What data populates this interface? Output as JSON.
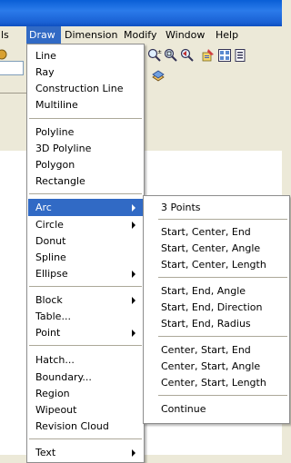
{
  "menubar": {
    "items": [
      {
        "label": "ls"
      },
      {
        "label": "Draw"
      },
      {
        "label": "Dimension"
      },
      {
        "label": "Modify"
      },
      {
        "label": "Window"
      },
      {
        "label": "Help"
      }
    ]
  },
  "toolbar": {
    "icons": [
      "zoom-realtime-icon",
      "zoom-window-icon",
      "zoom-previous-icon",
      "properties-icon",
      "design-center-icon",
      "tool-palettes-icon",
      "layer-icon"
    ]
  },
  "draw_menu": {
    "items": [
      {
        "label": "Line"
      },
      {
        "label": "Ray"
      },
      {
        "label": "Construction Line"
      },
      {
        "label": "Multiline"
      },
      {
        "label": "Polyline"
      },
      {
        "label": "3D Polyline"
      },
      {
        "label": "Polygon"
      },
      {
        "label": "Rectangle"
      },
      {
        "label": "Arc",
        "submenu": true,
        "highlighted": true
      },
      {
        "label": "Circle",
        "submenu": true
      },
      {
        "label": "Donut"
      },
      {
        "label": "Spline"
      },
      {
        "label": "Ellipse",
        "submenu": true
      },
      {
        "label": "Block",
        "submenu": true
      },
      {
        "label": "Table..."
      },
      {
        "label": "Point",
        "submenu": true
      },
      {
        "label": "Hatch..."
      },
      {
        "label": "Boundary..."
      },
      {
        "label": "Region"
      },
      {
        "label": "Wipeout"
      },
      {
        "label": "Revision Cloud"
      },
      {
        "label": "Text",
        "submenu": true
      }
    ]
  },
  "arc_submenu": {
    "items": [
      {
        "label": "3 Points"
      },
      {
        "label": "Start, Center, End"
      },
      {
        "label": "Start, Center, Angle"
      },
      {
        "label": "Start, Center, Length"
      },
      {
        "label": "Start, End, Angle"
      },
      {
        "label": "Start, End, Direction"
      },
      {
        "label": "Start, End, Radius"
      },
      {
        "label": "Center, Start, End"
      },
      {
        "label": "Center, Start, Angle"
      },
      {
        "label": "Center, Start, Length"
      },
      {
        "label": "Continue"
      }
    ]
  },
  "colors": {
    "highlight": "#316ac5",
    "title_bar": "#1a61d4",
    "menu_background": "#ffffff",
    "chrome": "#ece9d8"
  }
}
